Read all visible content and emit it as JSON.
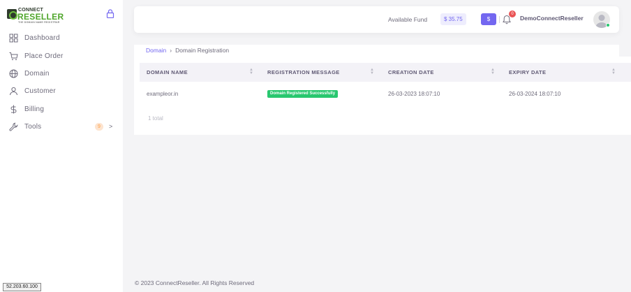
{
  "brand": {
    "line1": "CONNECT",
    "line2": "RESELLER",
    "tagline": "THE DOMAIN NAME REGISTRAR"
  },
  "sidebar": {
    "items": [
      {
        "label": "Dashboard",
        "icon": "grid-icon"
      },
      {
        "label": "Place Order",
        "icon": "cart-icon"
      },
      {
        "label": "Domain",
        "icon": "globe-icon"
      },
      {
        "label": "Customer",
        "icon": "user-icon"
      },
      {
        "label": "Billing",
        "icon": "dollar-icon"
      },
      {
        "label": "Tools",
        "icon": "wrench-icon",
        "badge": "9"
      }
    ]
  },
  "header": {
    "fund_label": "Available Fund",
    "fund_value": "$ 35.75",
    "dollar_button": "$",
    "notification_count": "0",
    "username": "DemoConnectReseller"
  },
  "breadcrumb": {
    "parent": "Domain",
    "separator": "›",
    "current": "Domain Registration"
  },
  "table": {
    "columns": [
      "DOMAIN NAME",
      "REGISTRATION MESSAGE",
      "CREATION DATE",
      "EXPIRY DATE"
    ],
    "rows": [
      {
        "domain": "exampleor.in",
        "message": "Domain Registered Successfully",
        "created": "26-03-2023 18:07:10",
        "expiry": "26-03-2024 18:07:10"
      }
    ],
    "total": "1 total"
  },
  "footer": "© 2023 ConnectReseller. All Rights Reserved",
  "ip_badge": "52.203.60.100",
  "colors": {
    "primary": "#7367f0",
    "success": "#28c76f",
    "danger": "#ea5455",
    "warning": "#ff9f43",
    "brand_green": "#4fa62b"
  }
}
